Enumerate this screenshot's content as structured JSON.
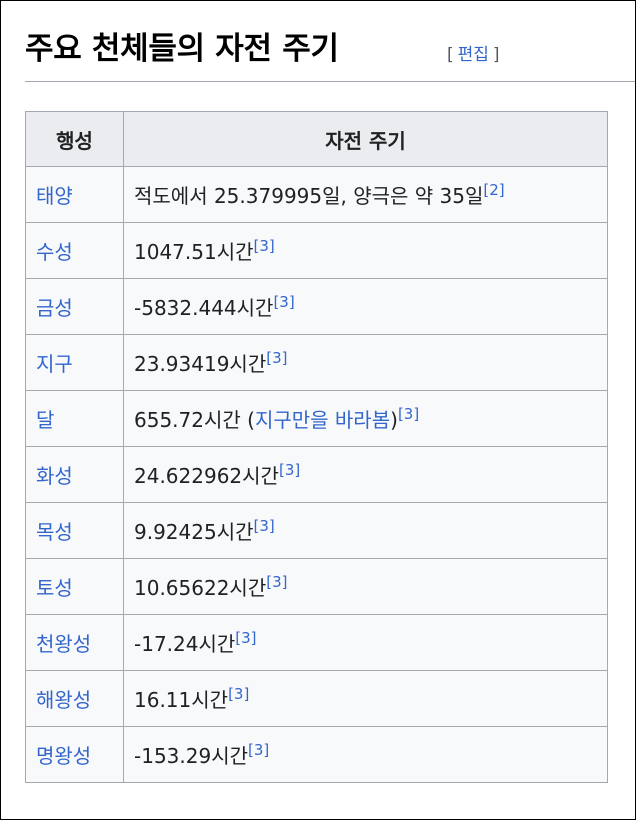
{
  "section": {
    "title": "주요 천체들의 자전 주기",
    "edit_open": "[",
    "edit_label": "편집",
    "edit_close": "]"
  },
  "table": {
    "headers": [
      "행성",
      "자전 주기"
    ],
    "rows": [
      {
        "planet": "태양",
        "prefix": "적도에서 25.379995일, 양극은 약 35일",
        "link": "",
        "suffix": "",
        "ref": "[2]"
      },
      {
        "planet": "수성",
        "prefix": "1047.51시간",
        "link": "",
        "suffix": "",
        "ref": "[3]"
      },
      {
        "planet": "금성",
        "prefix": "-5832.444시간",
        "link": "",
        "suffix": "",
        "ref": "[3]"
      },
      {
        "planet": "지구",
        "prefix": "23.93419시간",
        "link": "",
        "suffix": "",
        "ref": "[3]"
      },
      {
        "planet": "달",
        "prefix": "655.72시간 (",
        "link": "지구만을 바라봄",
        "suffix": ")",
        "ref": "[3]"
      },
      {
        "planet": "화성",
        "prefix": "24.622962시간",
        "link": "",
        "suffix": "",
        "ref": "[3]"
      },
      {
        "planet": "목성",
        "prefix": "9.92425시간",
        "link": "",
        "suffix": "",
        "ref": "[3]"
      },
      {
        "planet": "토성",
        "prefix": "10.65622시간",
        "link": "",
        "suffix": "",
        "ref": "[3]"
      },
      {
        "planet": "천왕성",
        "prefix": "-17.24시간",
        "link": "",
        "suffix": "",
        "ref": "[3]"
      },
      {
        "planet": "해왕성",
        "prefix": "16.11시간",
        "link": "",
        "suffix": "",
        "ref": "[3]"
      },
      {
        "planet": "명왕성",
        "prefix": "-153.29시간",
        "link": "",
        "suffix": "",
        "ref": "[3]"
      }
    ]
  },
  "colors": {
    "link": "#3366cc",
    "header_bg": "#eaecf0",
    "cell_bg": "#f8f9fa",
    "border": "#a2a9b1"
  }
}
